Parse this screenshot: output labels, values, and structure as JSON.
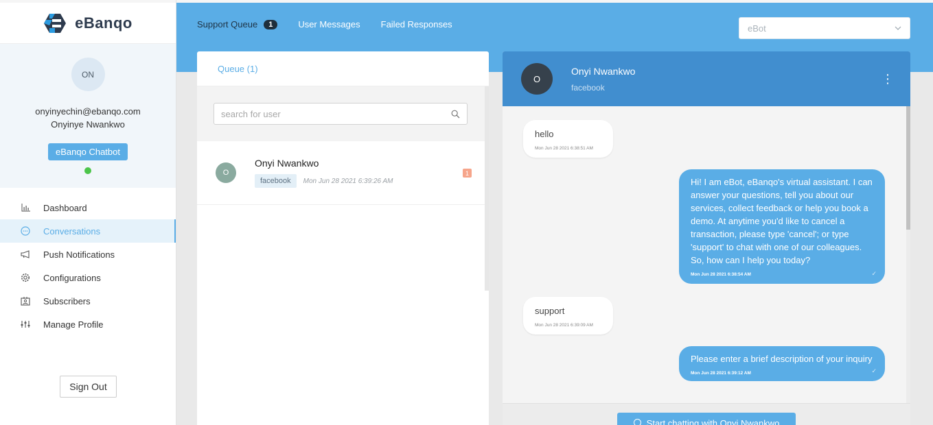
{
  "brand": {
    "name": "eBanqo"
  },
  "profile": {
    "initials": "ON",
    "email": "onyinyechin@ebanqo.com",
    "name": "Onyinye Nwankwo",
    "bot_badge": "eBanqo Chatbot",
    "status_color": "#4cc54a"
  },
  "nav": {
    "items": [
      {
        "label": "Dashboard",
        "icon": "bar-chart-icon"
      },
      {
        "label": "Conversations",
        "icon": "chat-bubble-icon",
        "active": true
      },
      {
        "label": "Push Notifications",
        "icon": "megaphone-icon"
      },
      {
        "label": "Configurations",
        "icon": "gear-icon"
      },
      {
        "label": "Subscribers",
        "icon": "subscriber-card-icon"
      },
      {
        "label": "Manage Profile",
        "icon": "profile-sliders-icon"
      }
    ],
    "sign_out": "Sign Out"
  },
  "topbar": {
    "tabs": [
      {
        "label": "Support Queue",
        "count": "1"
      },
      {
        "label": "User Messages"
      },
      {
        "label": "Failed Responses"
      }
    ],
    "bot_select": {
      "value": "eBot"
    }
  },
  "queue": {
    "title": "Queue (1)",
    "search_placeholder": "search for user",
    "items": [
      {
        "initial": "O",
        "name": "Onyi Nwankwo",
        "channel": "facebook",
        "time": "Mon Jun 28 2021 6:39:26 AM",
        "unread": "1"
      }
    ]
  },
  "chat": {
    "contact": {
      "initial": "O",
      "name": "Onyi Nwankwo",
      "source": "facebook"
    },
    "messages": [
      {
        "dir": "in",
        "text": "hello",
        "time": "Mon Jun 28 2021 6:38:51 AM"
      },
      {
        "dir": "out",
        "text": "Hi! I am eBot, eBanqo's virtual assistant. I can answer your questions, tell you about our services, collect feedback or help you book a demo. At anytime you'd like to cancel a transaction, please type 'cancel'; or type 'support' to chat with one of our colleagues. So, how can I help you today?",
        "time": "Mon Jun 28 2021 6:38:54 AM"
      },
      {
        "dir": "in",
        "text": "support",
        "time": "Mon Jun 28 2021 6:39:09 AM"
      },
      {
        "dir": "out",
        "text": "Please enter a brief description of your inquiry",
        "time": "Mon Jun 28 2021 6:39:12 AM"
      }
    ],
    "start_button": "Start chatting with Onyi Nwankwo"
  },
  "colors": {
    "accent": "#5aade6",
    "header_dark": "#418ecf",
    "unread": "#f6a58b"
  }
}
